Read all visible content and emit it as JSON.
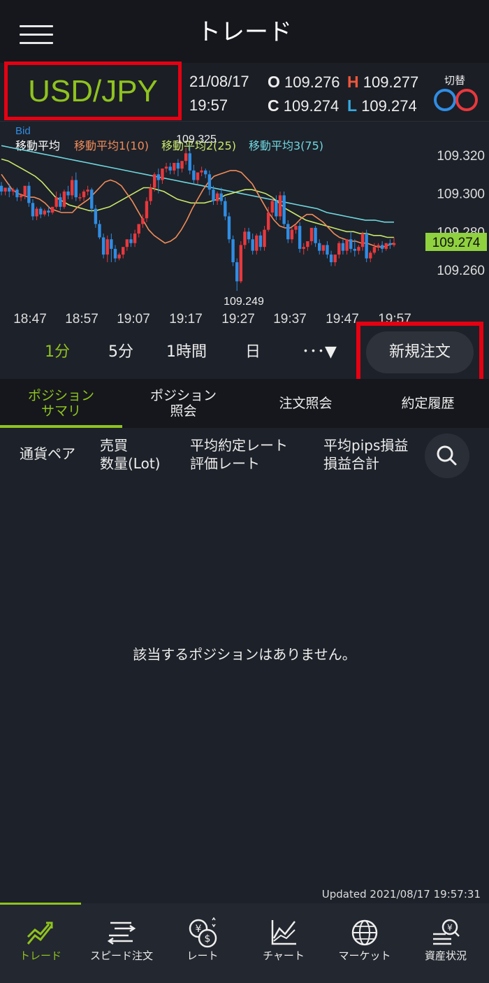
{
  "header": {
    "title": "トレード"
  },
  "quote": {
    "pair": "USD/JPY",
    "date": "21/08/17",
    "time": "19:57",
    "open_label": "O",
    "open": "109.276",
    "high_label": "H",
    "high": "109.277",
    "close_label": "C",
    "close": "109.274",
    "low_label": "L",
    "low": "109.274",
    "switch_label": "切替"
  },
  "chart": {
    "price_type": "Bid",
    "legend": [
      {
        "label": "移動平均",
        "color": "#ffffff"
      },
      {
        "label": "移動平均1(10)",
        "color": "#f08c5a"
      },
      {
        "label": "移動平均2(25)",
        "color": "#c9e86b"
      },
      {
        "label": "移動平均3(75)",
        "color": "#6fd7e0"
      }
    ],
    "high_marker": "109.325",
    "low_marker": "109.249",
    "current_price": "109.274",
    "y_ticks": [
      "109.320",
      "109.300",
      "109.280",
      "109.260"
    ],
    "x_ticks": [
      "18:47",
      "18:57",
      "19:07",
      "19:17",
      "19:27",
      "19:37",
      "19:47",
      "19:57"
    ],
    "colors": {
      "up": "#e8383d",
      "down": "#2f8de4",
      "current": "#8fd13f"
    }
  },
  "chart_data": {
    "type": "candlestick",
    "y_range": [
      109.245,
      109.33
    ],
    "x_range": [
      "18:45",
      "19:57"
    ],
    "candles": [
      {
        "o": 109.304,
        "h": 109.306,
        "c": 109.301,
        "l": 109.299
      },
      {
        "o": 109.301,
        "h": 109.303,
        "c": 109.303,
        "l": 109.299
      },
      {
        "o": 109.303,
        "h": 109.305,
        "c": 109.301,
        "l": 109.298
      },
      {
        "o": 109.301,
        "h": 109.303,
        "c": 109.302,
        "l": 109.299
      },
      {
        "o": 109.302,
        "h": 109.303,
        "c": 109.298,
        "l": 109.296
      },
      {
        "o": 109.298,
        "h": 109.3,
        "c": 109.299,
        "l": 109.296
      },
      {
        "o": 109.299,
        "h": 109.302,
        "c": 109.304,
        "l": 109.297
      },
      {
        "o": 109.304,
        "h": 109.306,
        "c": 109.295,
        "l": 109.293
      },
      {
        "o": 109.295,
        "h": 109.297,
        "c": 109.288,
        "l": 109.286
      },
      {
        "o": 109.288,
        "h": 109.293,
        "c": 109.292,
        "l": 109.286
      },
      {
        "o": 109.292,
        "h": 109.293,
        "c": 109.289,
        "l": 109.287
      },
      {
        "o": 109.289,
        "h": 109.292,
        "c": 109.291,
        "l": 109.288
      },
      {
        "o": 109.291,
        "h": 109.293,
        "c": 109.29,
        "l": 109.288
      },
      {
        "o": 109.29,
        "h": 109.293,
        "c": 109.293,
        "l": 109.289
      },
      {
        "o": 109.293,
        "h": 109.301,
        "c": 109.298,
        "l": 109.292
      },
      {
        "o": 109.298,
        "h": 109.3,
        "c": 109.293,
        "l": 109.291
      },
      {
        "o": 109.293,
        "h": 109.302,
        "c": 109.301,
        "l": 109.292
      },
      {
        "o": 109.301,
        "h": 109.304,
        "c": 109.299,
        "l": 109.297
      },
      {
        "o": 109.299,
        "h": 109.309,
        "c": 109.307,
        "l": 109.297
      },
      {
        "o": 109.307,
        "h": 109.311,
        "c": 109.298,
        "l": 109.296
      },
      {
        "o": 109.298,
        "h": 109.3,
        "c": 109.298,
        "l": 109.296
      },
      {
        "o": 109.298,
        "h": 109.302,
        "c": 109.301,
        "l": 109.296
      },
      {
        "o": 109.301,
        "h": 109.304,
        "c": 109.302,
        "l": 109.299
      },
      {
        "o": 109.302,
        "h": 109.303,
        "c": 109.292,
        "l": 109.29
      },
      {
        "o": 109.292,
        "h": 109.294,
        "c": 109.284,
        "l": 109.282
      },
      {
        "o": 109.284,
        "h": 109.286,
        "c": 109.277,
        "l": 109.276
      },
      {
        "o": 109.277,
        "h": 109.279,
        "c": 109.268,
        "l": 109.266
      },
      {
        "o": 109.268,
        "h": 109.278,
        "c": 109.276,
        "l": 109.264
      },
      {
        "o": 109.276,
        "h": 109.279,
        "c": 109.271,
        "l": 109.264
      },
      {
        "o": 109.271,
        "h": 109.273,
        "c": 109.266,
        "l": 109.264
      },
      {
        "o": 109.266,
        "h": 109.269,
        "c": 109.268,
        "l": 109.265
      },
      {
        "o": 109.268,
        "h": 109.271,
        "c": 109.272,
        "l": 109.266
      },
      {
        "o": 109.272,
        "h": 109.274,
        "c": 109.276,
        "l": 109.27
      },
      {
        "o": 109.276,
        "h": 109.279,
        "c": 109.274,
        "l": 109.272
      },
      {
        "o": 109.274,
        "h": 109.281,
        "c": 109.279,
        "l": 109.272
      },
      {
        "o": 109.279,
        "h": 109.282,
        "c": 109.284,
        "l": 109.277
      },
      {
        "o": 109.284,
        "h": 109.289,
        "c": 109.287,
        "l": 109.282
      },
      {
        "o": 109.287,
        "h": 109.298,
        "c": 109.296,
        "l": 109.285
      },
      {
        "o": 109.296,
        "h": 109.305,
        "c": 109.303,
        "l": 109.294
      },
      {
        "o": 109.303,
        "h": 109.311,
        "c": 109.31,
        "l": 109.301
      },
      {
        "o": 109.31,
        "h": 109.313,
        "c": 109.307,
        "l": 109.3
      },
      {
        "o": 109.307,
        "h": 109.313,
        "c": 109.313,
        "l": 109.305
      },
      {
        "o": 109.313,
        "h": 109.316,
        "c": 109.314,
        "l": 109.311
      },
      {
        "o": 109.314,
        "h": 109.316,
        "c": 109.312,
        "l": 109.31
      },
      {
        "o": 109.312,
        "h": 109.315,
        "c": 109.316,
        "l": 109.31
      },
      {
        "o": 109.316,
        "h": 109.318,
        "c": 109.313,
        "l": 109.309
      },
      {
        "o": 109.313,
        "h": 109.316,
        "c": 109.317,
        "l": 109.311
      },
      {
        "o": 109.317,
        "h": 109.324,
        "c": 109.321,
        "l": 109.315
      },
      {
        "o": 109.321,
        "h": 109.325,
        "c": 109.312,
        "l": 109.31
      },
      {
        "o": 109.312,
        "h": 109.315,
        "c": 109.307,
        "l": 109.305
      },
      {
        "o": 109.307,
        "h": 109.31,
        "c": 109.311,
        "l": 109.305
      },
      {
        "o": 109.311,
        "h": 109.314,
        "c": 109.312,
        "l": 109.309
      },
      {
        "o": 109.312,
        "h": 109.313,
        "c": 109.31,
        "l": 109.308
      },
      {
        "o": 109.31,
        "h": 109.312,
        "c": 109.302,
        "l": 109.299
      },
      {
        "o": 109.302,
        "h": 109.304,
        "c": 109.296,
        "l": 109.294
      },
      {
        "o": 109.296,
        "h": 109.301,
        "c": 109.3,
        "l": 109.294
      },
      {
        "o": 109.3,
        "h": 109.303,
        "c": 109.296,
        "l": 109.294
      },
      {
        "o": 109.296,
        "h": 109.298,
        "c": 109.288,
        "l": 109.286
      },
      {
        "o": 109.288,
        "h": 109.29,
        "c": 109.276,
        "l": 109.274
      },
      {
        "o": 109.276,
        "h": 109.278,
        "c": 109.264,
        "l": 109.262
      },
      {
        "o": 109.264,
        "h": 109.266,
        "c": 109.254,
        "l": 109.249
      },
      {
        "o": 109.254,
        "h": 109.275,
        "c": 109.273,
        "l": 109.253
      },
      {
        "o": 109.273,
        "h": 109.282,
        "c": 109.28,
        "l": 109.271
      },
      {
        "o": 109.28,
        "h": 109.282,
        "c": 109.276,
        "l": 109.274
      },
      {
        "o": 109.276,
        "h": 109.279,
        "c": 109.27,
        "l": 109.268
      },
      {
        "o": 109.27,
        "h": 109.279,
        "c": 109.278,
        "l": 109.268
      },
      {
        "o": 109.278,
        "h": 109.28,
        "c": 109.272,
        "l": 109.27
      },
      {
        "o": 109.272,
        "h": 109.283,
        "c": 109.281,
        "l": 109.27
      },
      {
        "o": 109.281,
        "h": 109.293,
        "c": 109.29,
        "l": 109.28
      },
      {
        "o": 109.29,
        "h": 109.298,
        "c": 109.296,
        "l": 109.288
      },
      {
        "o": 109.296,
        "h": 109.299,
        "c": 109.288,
        "l": 109.286
      },
      {
        "o": 109.288,
        "h": 109.301,
        "c": 109.299,
        "l": 109.286
      },
      {
        "o": 109.299,
        "h": 109.301,
        "c": 109.284,
        "l": 109.282
      },
      {
        "o": 109.284,
        "h": 109.286,
        "c": 109.276,
        "l": 109.274
      },
      {
        "o": 109.276,
        "h": 109.282,
        "c": 109.281,
        "l": 109.274
      },
      {
        "o": 109.281,
        "h": 109.284,
        "c": 109.283,
        "l": 109.279
      },
      {
        "o": 109.283,
        "h": 109.285,
        "c": 109.271,
        "l": 109.269
      },
      {
        "o": 109.271,
        "h": 109.274,
        "c": 109.272,
        "l": 109.268
      },
      {
        "o": 109.272,
        "h": 109.274,
        "c": 109.275,
        "l": 109.27
      },
      {
        "o": 109.275,
        "h": 109.28,
        "c": 109.282,
        "l": 109.273
      },
      {
        "o": 109.282,
        "h": 109.283,
        "c": 109.274,
        "l": 109.272
      },
      {
        "o": 109.274,
        "h": 109.276,
        "c": 109.27,
        "l": 109.268
      },
      {
        "o": 109.27,
        "h": 109.273,
        "c": 109.273,
        "l": 109.268
      },
      {
        "o": 109.273,
        "h": 109.275,
        "c": 109.268,
        "l": 109.266
      },
      {
        "o": 109.268,
        "h": 109.27,
        "c": 109.264,
        "l": 109.262
      },
      {
        "o": 109.264,
        "h": 109.266,
        "c": 109.268,
        "l": 109.262
      },
      {
        "o": 109.268,
        "h": 109.275,
        "c": 109.274,
        "l": 109.266
      },
      {
        "o": 109.274,
        "h": 109.276,
        "c": 109.27,
        "l": 109.268
      },
      {
        "o": 109.27,
        "h": 109.275,
        "c": 109.276,
        "l": 109.268
      },
      {
        "o": 109.276,
        "h": 109.28,
        "c": 109.271,
        "l": 109.269
      },
      {
        "o": 109.271,
        "h": 109.276,
        "c": 109.27,
        "l": 109.267
      },
      {
        "o": 109.27,
        "h": 109.273,
        "c": 109.272,
        "l": 109.268
      },
      {
        "o": 109.272,
        "h": 109.28,
        "c": 109.279,
        "l": 109.27
      },
      {
        "o": 109.279,
        "h": 109.281,
        "c": 109.266,
        "l": 109.264
      },
      {
        "o": 109.266,
        "h": 109.27,
        "c": 109.269,
        "l": 109.264
      },
      {
        "o": 109.269,
        "h": 109.274,
        "c": 109.272,
        "l": 109.268
      },
      {
        "o": 109.272,
        "h": 109.274,
        "c": 109.273,
        "l": 109.27
      },
      {
        "o": 109.273,
        "h": 109.275,
        "c": 109.271,
        "l": 109.269
      },
      {
        "o": 109.271,
        "h": 109.274,
        "c": 109.274,
        "l": 109.27
      },
      {
        "o": 109.274,
        "h": 109.276,
        "c": 109.273,
        "l": 109.271
      },
      {
        "o": 109.273,
        "h": 109.277,
        "c": 109.274,
        "l": 109.272
      }
    ],
    "ma1": [
      109.31,
      109.306,
      109.302,
      109.3,
      109.299,
      109.298,
      109.298,
      109.297,
      109.295,
      109.292,
      109.291,
      109.29,
      109.29,
      109.29,
      109.293,
      109.295,
      109.297,
      109.3,
      109.303,
      109.306,
      109.307,
      109.306,
      109.304,
      109.3,
      109.296,
      109.291,
      109.286,
      109.281,
      109.278,
      109.276,
      109.274,
      109.275,
      109.277,
      109.281,
      109.286,
      109.292,
      109.297,
      109.302,
      109.306,
      109.309,
      109.31,
      109.311,
      109.312,
      109.312,
      109.311,
      109.308,
      109.305,
      109.3,
      109.295,
      109.29,
      109.286,
      109.283,
      109.282,
      109.282,
      109.284,
      109.287,
      109.289,
      109.289,
      109.287,
      109.285,
      109.282,
      109.279,
      109.277,
      109.276,
      109.275,
      109.275,
      109.274,
      109.274,
      109.273,
      109.272,
      109.272,
      109.273,
      109.274
    ],
    "ma2": [
      109.318,
      109.317,
      109.315,
      109.313,
      109.311,
      109.309,
      109.306,
      109.302,
      109.298,
      109.296,
      109.294,
      109.293,
      109.292,
      109.291,
      109.291,
      109.292,
      109.293,
      109.295,
      109.297,
      109.299,
      109.301,
      109.303,
      109.303,
      109.302,
      109.301,
      109.299,
      109.297,
      109.296,
      109.295,
      109.295,
      109.295,
      109.296,
      109.297,
      109.299,
      109.3,
      109.301,
      109.302,
      109.302,
      109.301,
      109.3,
      109.298,
      109.295,
      109.292,
      109.29,
      109.288,
      109.286,
      109.285,
      109.284,
      109.283,
      109.282,
      109.281,
      109.28,
      109.28,
      109.279,
      109.279,
      109.278,
      109.278,
      109.277,
      109.277
    ],
    "ma3": [
      109.325,
      109.324,
      109.323,
      109.322,
      109.321,
      109.32,
      109.319,
      109.318,
      109.317,
      109.316,
      109.315,
      109.314,
      109.313,
      109.312,
      109.311,
      109.31,
      109.309,
      109.308,
      109.307,
      109.306,
      109.305,
      109.304,
      109.303,
      109.302,
      109.301,
      109.3,
      109.299,
      109.298,
      109.297,
      109.296,
      109.295,
      109.294,
      109.293,
      109.292,
      109.29,
      109.289,
      109.288,
      109.287,
      109.286,
      109.286,
      109.285,
      109.285
    ]
  },
  "timeframes": {
    "m1": "1分",
    "m5": "5分",
    "h1": "1時間",
    "d": "日",
    "more": "･･･▼"
  },
  "new_order_label": "新規注文",
  "tabs": {
    "summary": [
      "ポジション",
      "サマリ"
    ],
    "inquiry": [
      "ポジション",
      "照会"
    ],
    "orders": "注文照会",
    "history": "約定履歴"
  },
  "columns": {
    "pair": "通貨ペア",
    "side": "売買",
    "qty": "数量(Lot)",
    "avg_rate": "平均約定レート",
    "eval_rate": "評価レート",
    "avg_pips": "平均pips損益",
    "total_pl": "損益合計"
  },
  "empty_message": "該当するポジションはありません。",
  "updated": "Updated  2021/08/17 19:57:31",
  "nav": {
    "trade": "トレード",
    "speed": "スピード注文",
    "rate": "レート",
    "chart": "チャート",
    "market": "マーケット",
    "assets": "資産状況"
  }
}
